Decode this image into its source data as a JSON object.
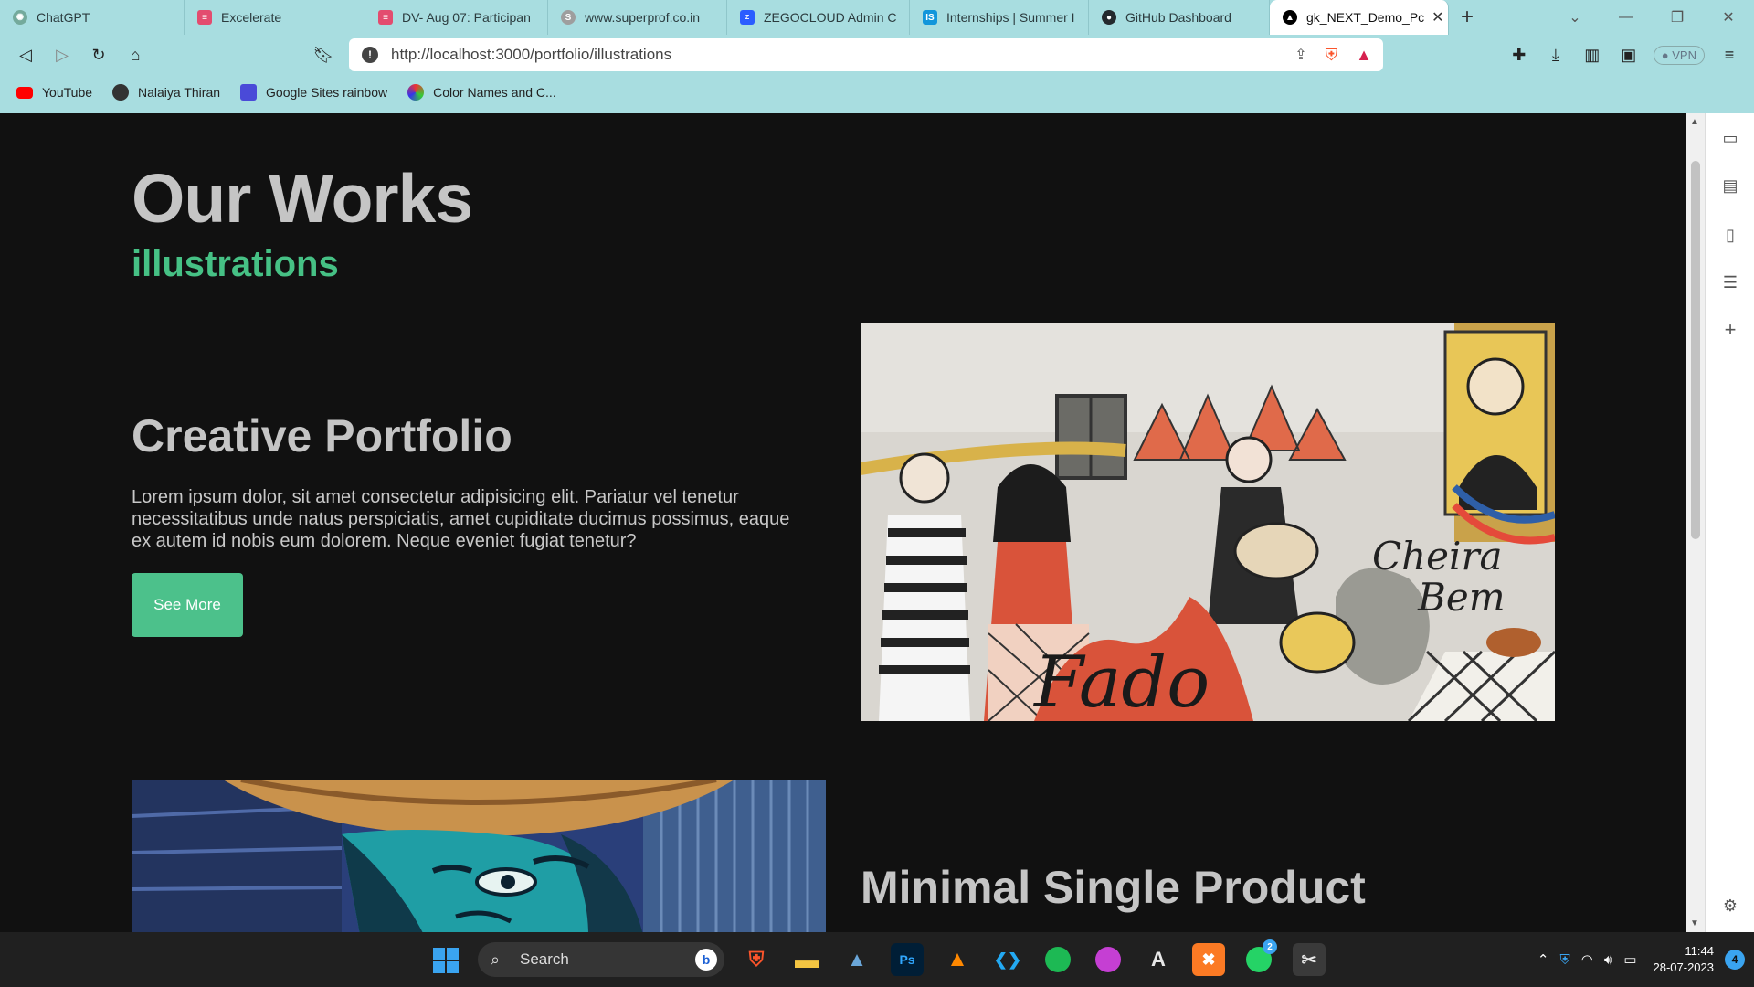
{
  "browser": {
    "tabs": [
      {
        "label": "ChatGPT",
        "icon": "chatgpt-icon",
        "color": "#74aa9c"
      },
      {
        "label": "Excelerate",
        "icon": "excelerate-icon",
        "color": "#e34c6f"
      },
      {
        "label": "DV- Aug 07: Participan",
        "icon": "docs-icon",
        "color": "#e34c6f"
      },
      {
        "label": "www.superprof.co.in",
        "icon": "superprof-icon",
        "color": "#9e9e9e"
      },
      {
        "label": "ZEGOCLOUD Admin C",
        "icon": "zegocloud-icon",
        "color": "#2b5cff"
      },
      {
        "label": "Internships | Summer I",
        "icon": "internshala-icon",
        "color": "#1296db"
      },
      {
        "label": "GitHub Dashboard",
        "icon": "github-icon",
        "color": "#24292e"
      },
      {
        "label": "gk_NEXT_Demo_Pc",
        "icon": "nextjs-icon",
        "color": "#000000"
      }
    ],
    "url": "http://localhost:3000/portfolio/illustrations",
    "vpn_label": "VPN",
    "bookmarks": [
      {
        "label": "YouTube",
        "icon": "youtube-icon",
        "color": "#ff0000"
      },
      {
        "label": "Nalaiya Thiran",
        "icon": "globe-icon",
        "color": "#333333"
      },
      {
        "label": "Google Sites rainbow",
        "icon": "google-sites-icon",
        "color": "#4a4ad8"
      },
      {
        "label": "Color Names and C...",
        "icon": "color-wheel-icon",
        "color": "#1a1a1a"
      }
    ]
  },
  "page": {
    "title": "Our Works",
    "subtitle": "illustrations",
    "accent_color": "#46c185",
    "items": [
      {
        "title": "Creative Portfolio",
        "description": "Lorem ipsum dolor, sit amet consectetur adipisicing elit. Pariatur vel tenetur necessitatibus unde natus perspiciatis, amet cupiditate ducimus possimus, eaque ex autem id nobis eum dolorem. Neque eveniet fugiat tenetur?",
        "button_label": "See More"
      },
      {
        "title": "Minimal Single Product"
      }
    ]
  },
  "taskbar": {
    "search_label": "Search",
    "apps": [
      {
        "name": "brave-icon",
        "color": "#fb542b",
        "glyph": "B"
      },
      {
        "name": "file-explorer-icon",
        "color": "#f4c542",
        "glyph": "▬"
      },
      {
        "name": "photos-icon",
        "color": "#6aa6d8",
        "glyph": "▲"
      },
      {
        "name": "photoshop-icon",
        "color": "#001e36",
        "glyph": "Ps"
      },
      {
        "name": "vlc-icon",
        "color": "#ff8800",
        "glyph": "▲"
      },
      {
        "name": "vscode-icon",
        "color": "#23a9f2",
        "glyph": "❮❯"
      },
      {
        "name": "spotify-icon",
        "color": "#1db954",
        "glyph": "≋"
      },
      {
        "name": "podcast-icon",
        "color": "#c53fd3",
        "glyph": "≋"
      },
      {
        "name": "acrobat-icon",
        "color": "#d32f2f",
        "glyph": "A"
      },
      {
        "name": "xampp-icon",
        "color": "#fb7a24",
        "glyph": "✖"
      },
      {
        "name": "whatsapp-icon",
        "color": "#25d366",
        "glyph": "✆"
      },
      {
        "name": "snipping-tool-icon",
        "color": "#e8e8e8",
        "glyph": "✂"
      }
    ],
    "whatsapp_badge": "2",
    "time": "11:44",
    "date": "28-07-2023",
    "notification_count": "4"
  }
}
